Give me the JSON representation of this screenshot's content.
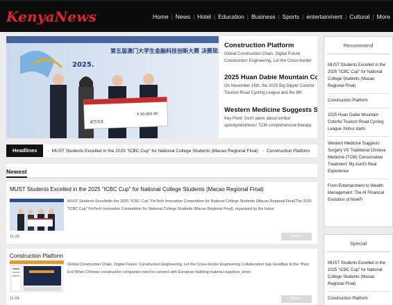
{
  "header": {
    "logo": "KenyaNews",
    "nav": [
      "Home",
      "News",
      "Hotel",
      "Education",
      "Business",
      "Sports",
      "entertainment",
      "Cultural",
      "More"
    ]
  },
  "hero": {
    "image_banner": "第五届澳门大学生金融科技创新大赛 决赛现场颁奖典礼",
    "image_year": "2025.",
    "check_amount": "¥ 20,000.00",
    "check_words": "贰万元正",
    "stories": [
      {
        "title": "Construction Platform",
        "text": "Global Construction Chain, Digital Future: Construction Engineering, Let the Cross-border"
      },
      {
        "title": "2025 Huan Dabie Mountain Co...",
        "text": "On November 16th, the 2025 Big Dipper Colorful Tourism Road Cycling League and the 8th"
      },
      {
        "title": "Western Medicine Suggests S...",
        "text": "Key Point: Don't panic about lumbar spondylolisthesis! TCM comprehensive therapy"
      }
    ]
  },
  "headlines": {
    "tag": "Headlines",
    "items": [
      "MUST Students Excelled in the 2025 \"ICBC Cup\" for National College Students (Macao Regional Final)",
      "Construction Platform"
    ]
  },
  "newest": {
    "title": "Newest",
    "articles": [
      {
        "title": "MUST Students Excelled in the 2025 \"ICBC Cup\" for National College Students (Macao Regional Final)",
        "summary": "MUST Students Excelledin the 2025 \"ICBC Cup\" FinTech Innovation Competition for National College Students (Macao Regional Final)The 2025 \"ICBC Cup\" FinTech Innovation Competition for National College Students (Macao Regional Final), organized by the Indus",
        "date": "11-25",
        "button": "Detail"
      },
      {
        "title": "Construction Platform",
        "summary": "Global Construction Chain, Digital Future: Construction Engineering, Let the Cross-border Engineering Collaboration Say Goodbye to the \"Pain Era\"When Chinese construction companies need to connect with European building material suppliers, when",
        "date": "11-24",
        "button": "Detail"
      }
    ]
  },
  "recommend": {
    "title": "Recommend",
    "items": [
      "MUST Students Excelled in the 2025 \"ICBC Cup\" for National College Students (Macao Regional Final)",
      "Construction Platform",
      "2025 Huan Dabie Mountain Colorful Tourism Road Cycling League Xishui starts",
      "Western Medicine Suggests Surgery VS Traditional Chinese Medicine (TCM) Conservative Treatment: My Aunt's Real Experience",
      "From Entertainment to Wealth Management: The AI Financial Evolution of NineFi"
    ]
  },
  "special": {
    "title": "Special",
    "items": [
      "MUST Students Excelled in the 2025 \"ICBC Cup\" for National College Students (Macao Regional Final)",
      "Construction Platform"
    ]
  },
  "colors": {
    "logo": "#e3252a",
    "header_bg": "#0b0b0b",
    "page_bg": "#ececec",
    "detail_button": "#d9d9d9"
  }
}
